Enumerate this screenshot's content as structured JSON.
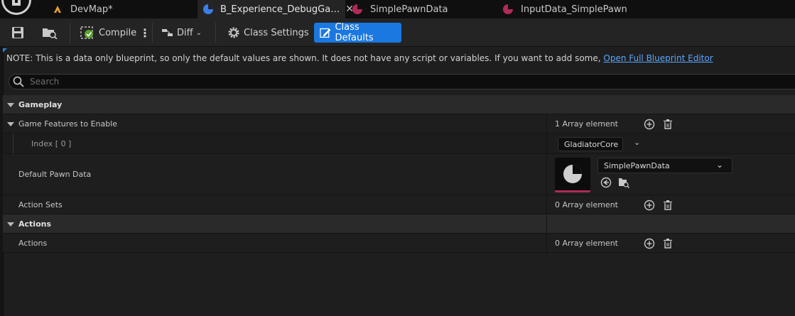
{
  "tabs": [
    {
      "label": "DevMap*",
      "icon": "level-map-icon"
    },
    {
      "label": "B_Experience_DebugGa…",
      "icon": "blueprint-icon",
      "active": true
    },
    {
      "label": "SimplePawnData",
      "icon": "data-asset-icon"
    },
    {
      "label": "InputData_SimplePawn",
      "icon": "data-asset-icon"
    }
  ],
  "toolbar": {
    "compile_label": "Compile",
    "diff_label": "Diff",
    "class_settings_label": "Class Settings",
    "class_defaults_label": "Class Defaults"
  },
  "note": {
    "text": "NOTE: This is a data only blueprint, so only the default values are shown.  It does not have any script or variables.  If you want to add some,",
    "link": "Open Full Blueprint Editor"
  },
  "search": {
    "placeholder": "Search"
  },
  "details": {
    "gameplay": {
      "title": "Gameplay",
      "game_features_label": "Game Features to Enable",
      "game_features_value": "1 Array element",
      "index_label": "Index [ 0 ]",
      "index_value": "GladiatorCore",
      "pawn_data_label": "Default Pawn Data",
      "pawn_data_value": "SimplePawnData",
      "action_sets_label": "Action Sets",
      "action_sets_value": "0 Array element"
    },
    "actions": {
      "title": "Actions",
      "actions_label": "Actions",
      "actions_value": "0 Array element"
    }
  },
  "colors": {
    "accent_blue": "#1a78e0",
    "link_blue": "#5aa7ff",
    "asset_magenta": "#b02a57"
  }
}
